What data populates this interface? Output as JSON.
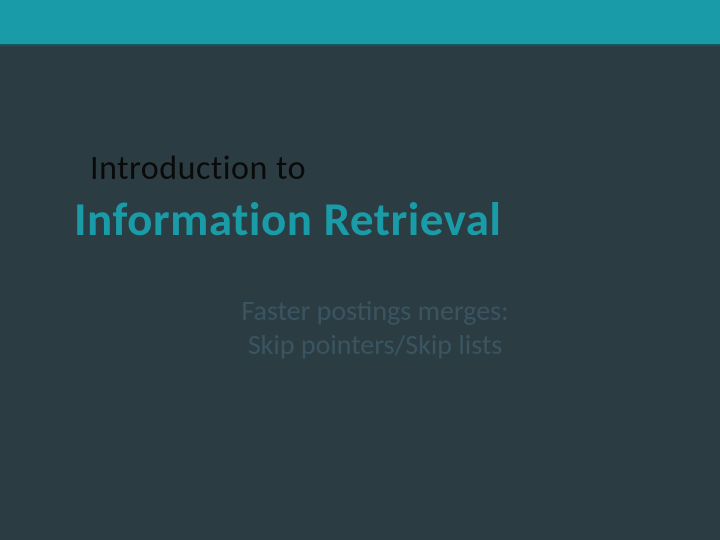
{
  "slide": {
    "overline": "Introduction to",
    "title": "Information Retrieval",
    "subtitle_line1": "Faster postings merges:",
    "subtitle_line2": "Skip pointers/Skip lists"
  }
}
